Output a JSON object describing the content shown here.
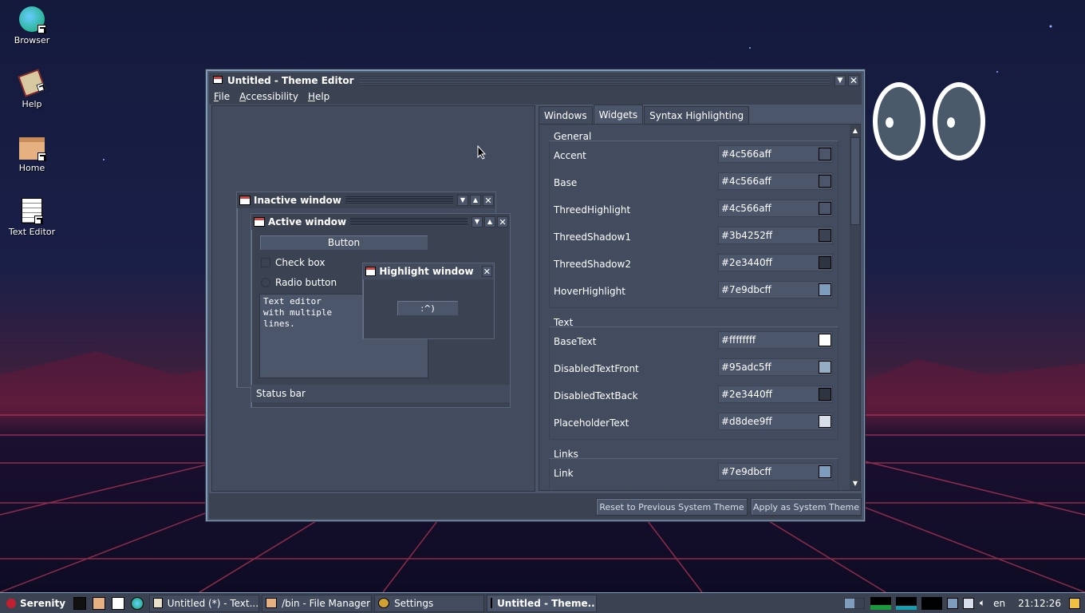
{
  "desktop": {
    "icons": [
      {
        "label": "Browser"
      },
      {
        "label": "Help"
      },
      {
        "label": "Home"
      },
      {
        "label": "Text Editor"
      }
    ]
  },
  "window": {
    "title": "Untitled - Theme Editor",
    "menu": [
      "File",
      "Accessibility",
      "Help"
    ]
  },
  "preview": {
    "inactive_title": "Inactive window",
    "active_title": "Active window",
    "highlight_title": "Highlight window",
    "button_label": "Button",
    "checkbox_label": "Check box",
    "radio_label": "Radio button",
    "textarea_value": "Text editor\nwith multiple\nlines.",
    "status_bar": "Status bar",
    "highlight_button": ":^)"
  },
  "tabs": [
    "Windows",
    "Widgets",
    "Syntax Highlighting"
  ],
  "active_tab": "Widgets",
  "groups": [
    {
      "title": "General",
      "rows": [
        {
          "name": "Accent",
          "value": "#4c566aff",
          "color": "#4c566a"
        },
        {
          "name": "Base",
          "value": "#4c566aff",
          "color": "#4c566a"
        },
        {
          "name": "ThreedHighlight",
          "value": "#4c566aff",
          "color": "#4c566a"
        },
        {
          "name": "ThreedShadow1",
          "value": "#3b4252ff",
          "color": "#3b4252"
        },
        {
          "name": "ThreedShadow2",
          "value": "#2e3440ff",
          "color": "#2e3440"
        },
        {
          "name": "HoverHighlight",
          "value": "#7e9dbcff",
          "color": "#7e9dbc"
        }
      ]
    },
    {
      "title": "Text",
      "rows": [
        {
          "name": "BaseText",
          "value": "#ffffffff",
          "color": "#ffffff"
        },
        {
          "name": "DisabledTextFront",
          "value": "#95adc5ff",
          "color": "#95adc5"
        },
        {
          "name": "DisabledTextBack",
          "value": "#2e3440ff",
          "color": "#2e3440"
        },
        {
          "name": "PlaceholderText",
          "value": "#d8dee9ff",
          "color": "#d8dee9"
        }
      ]
    },
    {
      "title": "Links",
      "rows": [
        {
          "name": "Link",
          "value": "#7e9dbcff",
          "color": "#7e9dbc"
        }
      ]
    }
  ],
  "buttons": {
    "reset": "Reset to Previous System Theme",
    "apply": "Apply as System Theme"
  },
  "taskbar": {
    "start_label": "Serenity",
    "tasks": [
      {
        "label": "Untitled (*) - Text..."
      },
      {
        "label": "/bin - File Manager"
      },
      {
        "label": "Settings"
      },
      {
        "label": "Untitled - Theme..."
      }
    ],
    "keyboard_layout": "en",
    "clock": "21:12:26"
  }
}
